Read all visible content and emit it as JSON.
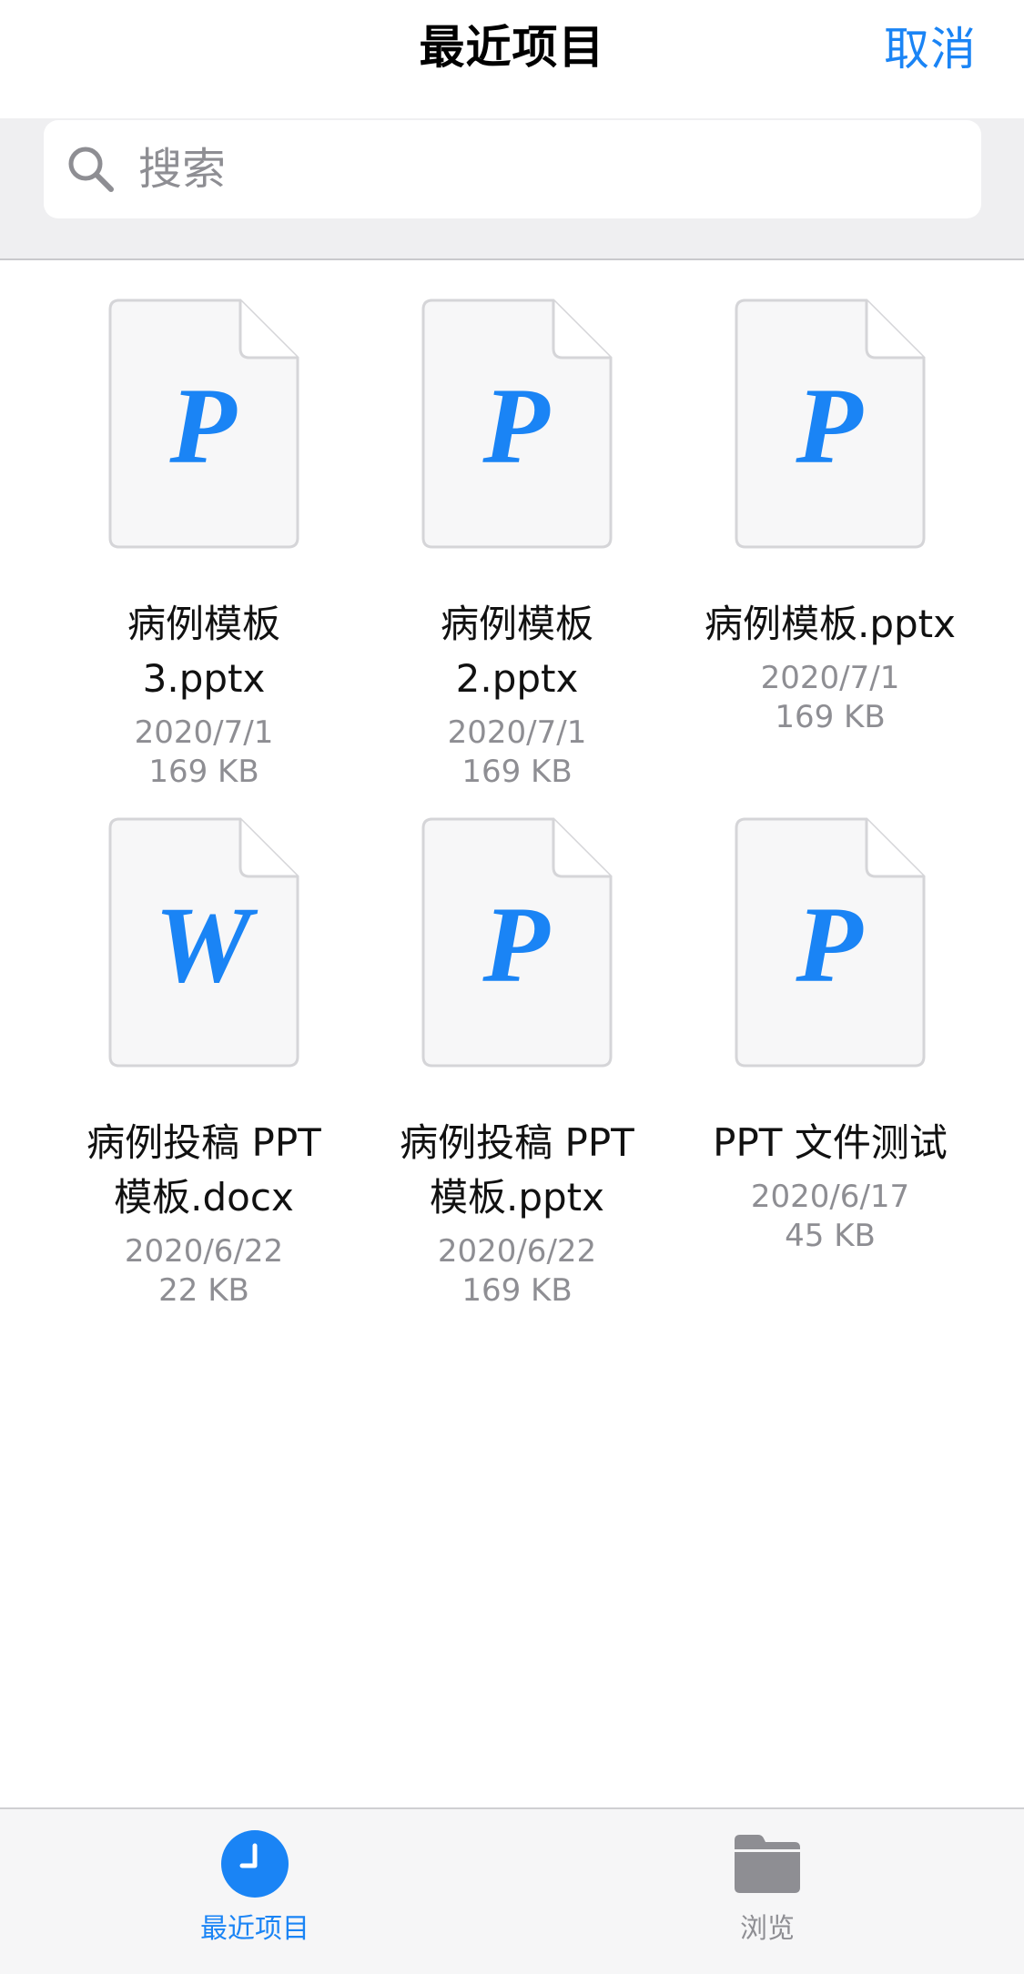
{
  "header": {
    "title": "最近项目",
    "cancel_label": "取消"
  },
  "search": {
    "placeholder": "搜索"
  },
  "files": [
    {
      "icon_letter": "P",
      "name_line1": "病例模板",
      "name_line2": "3.pptx",
      "date": "2020/7/1",
      "size": "169 KB"
    },
    {
      "icon_letter": "P",
      "name_line1": "病例模板",
      "name_line2": "2.pptx",
      "date": "2020/7/1",
      "size": "169 KB"
    },
    {
      "icon_letter": "P",
      "name_line1": "病例模板.pptx",
      "date": "2020/7/1",
      "size": "169 KB"
    },
    {
      "icon_letter": "W",
      "name_line1": "病例投稿 PPT",
      "name_line2": "模板.docx",
      "date": "2020/6/22",
      "size": "22 KB"
    },
    {
      "icon_letter": "P",
      "name_line1": "病例投稿 PPT",
      "name_line2": "模板.pptx",
      "date": "2020/6/22",
      "size": "169 KB"
    },
    {
      "icon_letter": "P",
      "name_line1": "PPT 文件测试",
      "date": "2020/6/17",
      "size": "45 KB"
    }
  ],
  "tabs": [
    {
      "label": "最近项目",
      "icon": "clock-icon",
      "active": true
    },
    {
      "label": "浏览",
      "icon": "folder-icon",
      "active": false
    }
  ],
  "colors": {
    "accent": "#1a84f5",
    "secondary_text": "#8e8e93",
    "inactive_tab": "#8e8e93"
  }
}
